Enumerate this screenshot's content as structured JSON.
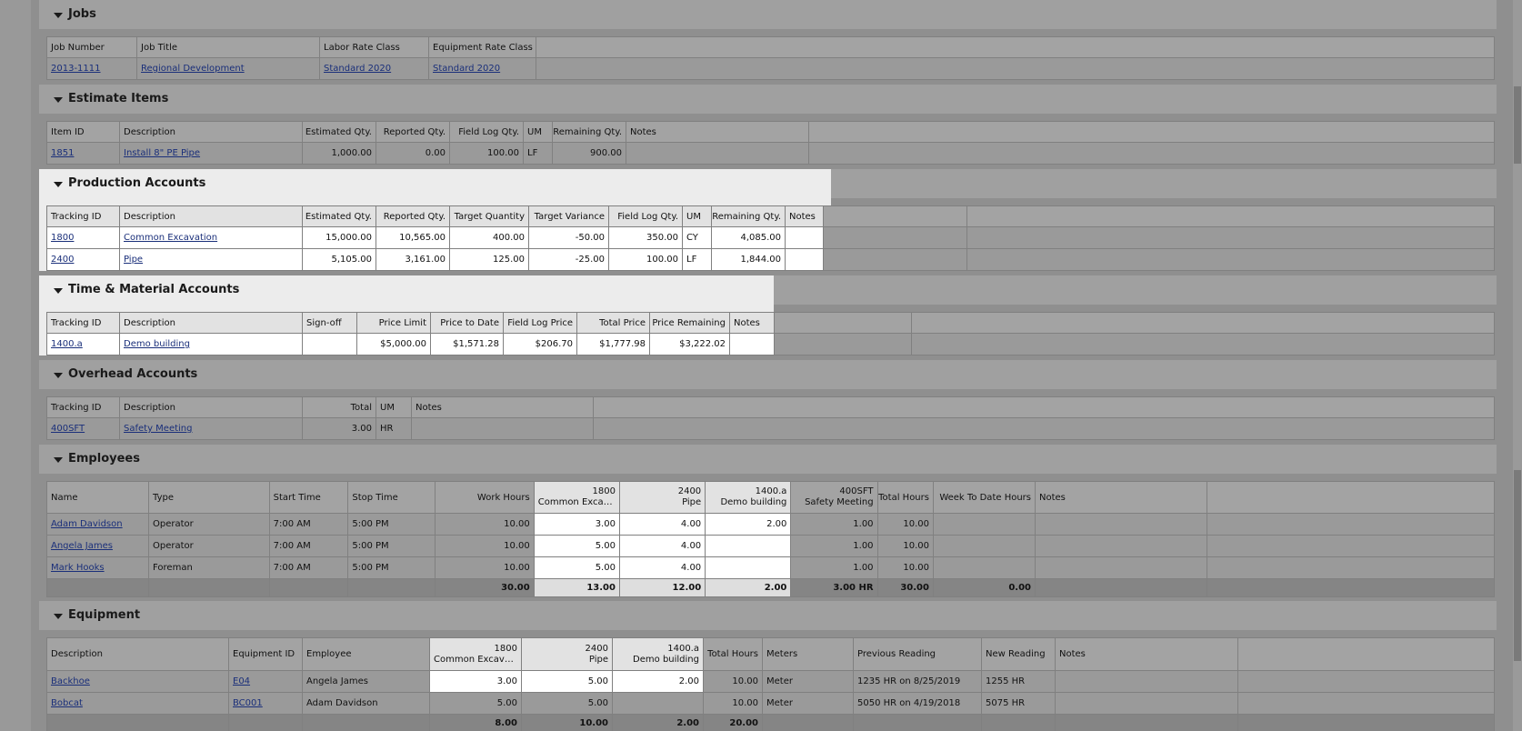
{
  "sections": {
    "jobs": "Jobs",
    "estimate": "Estimate Items",
    "production": "Production Accounts",
    "tm": "Time & Material Accounts",
    "overhead": "Overhead Accounts",
    "employees": "Employees",
    "equipment": "Equipment"
  },
  "jobs": {
    "headers": [
      "Job Number",
      "Job Title",
      "Labor Rate Class",
      "Equipment Rate Class"
    ],
    "rows": [
      [
        "2013-1111",
        "Regional Development",
        "Standard 2020",
        "Standard 2020"
      ]
    ]
  },
  "estimate": {
    "headers": [
      "Item ID",
      "Description",
      "Estimated Qty.",
      "Reported Qty.",
      "Field Log Qty.",
      "UM",
      "Remaining Qty.",
      "Notes"
    ],
    "rows": [
      [
        "1851",
        "Install 8\" PE Pipe",
        "1,000.00",
        "0.00",
        "100.00",
        "LF",
        "900.00",
        ""
      ]
    ]
  },
  "production": {
    "headers": [
      "Tracking ID",
      "Description",
      "Estimated Qty.",
      "Reported Qty.",
      "Target Quantity",
      "Target Variance",
      "Field Log Qty.",
      "UM",
      "Remaining Qty.",
      "Notes"
    ],
    "rows": [
      [
        "1800",
        "Common Excavation",
        "15,000.00",
        "10,565.00",
        "400.00",
        "-50.00",
        "350.00",
        "CY",
        "4,085.00",
        ""
      ],
      [
        "2400",
        "Pipe",
        "5,105.00",
        "3,161.00",
        "125.00",
        "-25.00",
        "100.00",
        "LF",
        "1,844.00",
        ""
      ]
    ]
  },
  "tm": {
    "headers": [
      "Tracking ID",
      "Description",
      "Sign-off",
      "Price Limit",
      "Price to Date",
      "Field Log Price",
      "Total Price",
      "Price Remaining",
      "Notes"
    ],
    "rows": [
      [
        "1400.a",
        "Demo building",
        "",
        "$5,000.00",
        "$1,571.28",
        "$206.70",
        "$1,777.98",
        "$3,222.02",
        ""
      ]
    ]
  },
  "overhead": {
    "headers": [
      "Tracking ID",
      "Description",
      "Total",
      "UM",
      "Notes"
    ],
    "rows": [
      [
        "400SFT",
        "Safety Meeting",
        "3.00",
        "HR",
        ""
      ]
    ]
  },
  "employees": {
    "headers": [
      "Name",
      "Type",
      "Start Time",
      "Stop Time",
      "Work Hours",
      "1800",
      "Common Excavati...",
      "2400",
      "Pipe",
      "1400.a",
      "Demo building",
      "400SFT",
      "Safety Meeting",
      "Total Hours",
      "Week To Date Hours",
      "Notes"
    ],
    "rows": [
      [
        "Adam Davidson",
        "Operator",
        "7:00 AM",
        "5:00 PM",
        "10.00",
        "3.00",
        "4.00",
        "2.00",
        "1.00",
        "10.00",
        "",
        ""
      ],
      [
        "Angela James",
        "Operator",
        "7:00 AM",
        "5:00 PM",
        "10.00",
        "5.00",
        "4.00",
        "",
        "1.00",
        "10.00",
        "",
        ""
      ],
      [
        "Mark Hooks",
        "Foreman",
        "7:00 AM",
        "5:00 PM",
        "10.00",
        "5.00",
        "4.00",
        "",
        "1.00",
        "10.00",
        "",
        ""
      ]
    ],
    "totals": [
      "30.00",
      "13.00",
      "12.00",
      "2.00",
      "3.00 HR",
      "30.00",
      "0.00"
    ]
  },
  "equipment": {
    "headers": [
      "Description",
      "Equipment ID",
      "Employee",
      "1800",
      "Common Excavati...",
      "2400",
      "Pipe",
      "1400.a",
      "Demo building",
      "Total Hours",
      "Meters",
      "Previous Reading",
      "New Reading",
      "Notes"
    ],
    "rows": [
      [
        "Backhoe",
        "E04",
        "Angela James",
        "3.00",
        "5.00",
        "2.00",
        "10.00",
        "Meter",
        "1235 HR on 8/25/2019",
        "1255 HR",
        ""
      ],
      [
        "Bobcat",
        "BC001",
        "Adam Davidson",
        "5.00",
        "5.00",
        "",
        "10.00",
        "Meter",
        "5050 HR on 4/19/2018",
        "5075 HR",
        ""
      ]
    ],
    "totals": [
      "8.00",
      "10.00",
      "2.00",
      "20.00"
    ]
  }
}
